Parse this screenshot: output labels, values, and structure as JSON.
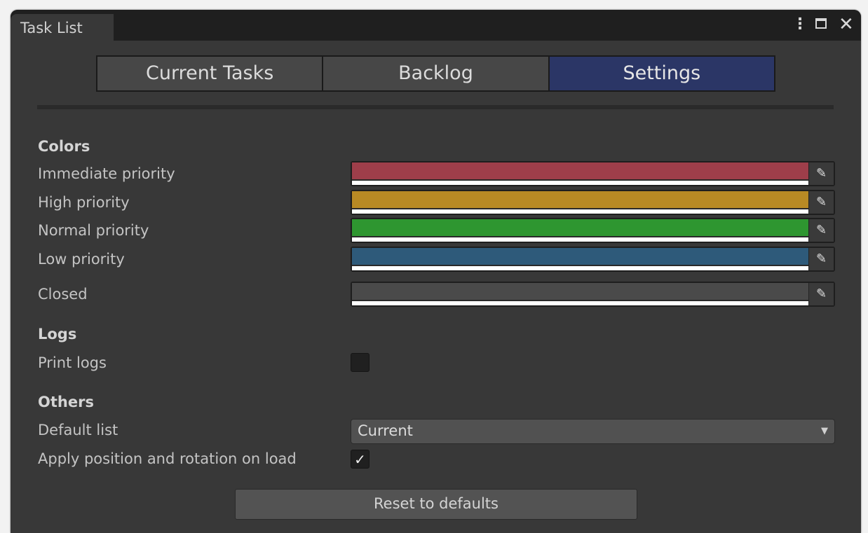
{
  "window": {
    "title": "Task List",
    "controls": {
      "more_icon": "⋮",
      "maximize_icon": "maximize-icon",
      "close_icon": "✕"
    }
  },
  "tabs": [
    {
      "label": "Current Tasks",
      "active": false
    },
    {
      "label": "Backlog",
      "active": false
    },
    {
      "label": "Settings",
      "active": true
    }
  ],
  "colors_section": {
    "header": "Colors",
    "fields": [
      {
        "label": "Immediate priority",
        "color": "#9e3e4a"
      },
      {
        "label": "High priority",
        "color": "#b88a24"
      },
      {
        "label": "Normal priority",
        "color": "#2e9630"
      },
      {
        "label": "Low priority",
        "color": "#2e5a7a"
      },
      {
        "label": "Closed",
        "color": "#4a4a4a"
      }
    ],
    "picker_icon": "eyedropper-icon"
  },
  "logs_section": {
    "header": "Logs",
    "print_logs_label": "Print logs",
    "print_logs_checked": false
  },
  "others_section": {
    "header": "Others",
    "default_list_label": "Default list",
    "default_list_value": "Current",
    "apply_label": "Apply position and rotation on load",
    "apply_checked": true
  },
  "reset_button_label": "Reset to defaults"
}
